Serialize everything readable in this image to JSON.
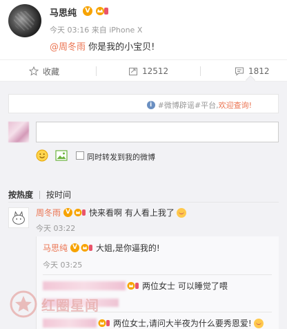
{
  "post": {
    "author": "马思纯",
    "verified_badge": "V",
    "meta": "今天 03:16 来自 iPhone X",
    "mention": "@周冬雨",
    "text": " 你是我的小宝贝!"
  },
  "actions": {
    "favorite_label": "收藏",
    "repost_count": "12512",
    "comment_count": "1812"
  },
  "rumor_bar": {
    "prefix": "#微博辟谣#平台,",
    "link": "欢迎查询!"
  },
  "compose": {
    "input_value": "",
    "forward_label": "同时转发到我的微博"
  },
  "sort": {
    "by_hot": "按热度",
    "by_time": "按时间"
  },
  "comments": [
    {
      "name": "周冬雨",
      "text": "快来看啊 有人看上我了",
      "time": "今天 03:22"
    }
  ],
  "replies": [
    {
      "name": "马思纯",
      "text": "大姐,是你逼我的!",
      "time": "今天 03:25"
    },
    {
      "name": "",
      "text": "两位女士 可以睡觉了喂"
    },
    {
      "name": "",
      "text": "两位女士,请问大半夜为什么要秀恩爱!"
    }
  ],
  "watermark": {
    "text": "红圈星闻"
  },
  "colors": {
    "accent": "#eb7350",
    "verified": "#f7a300",
    "panel_bg": "#f2f2f5"
  }
}
